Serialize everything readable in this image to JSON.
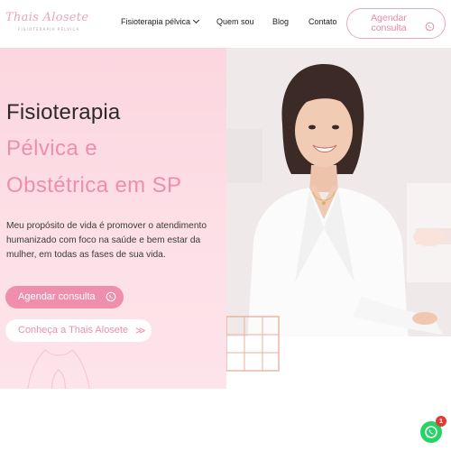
{
  "header": {
    "logo_script": "Thais Alosete",
    "logo_tagline": "FISIOTERAPIA PÉLVICA",
    "nav": {
      "fisio": "Fisioterapia pélvica",
      "quem": "Quem sou",
      "blog": "Blog",
      "contato": "Contato"
    },
    "cta_line1": "Agendar",
    "cta_line2": "consulta"
  },
  "hero": {
    "title_line1": "Fisioterapia",
    "title_line2": "Pélvica e",
    "title_line3": "Obstétrica em SP",
    "description": "Meu propósito de vida é promover o atendimento humanizado com foco na saúde e bem estar da mulher, em todas as fases de sua vida.",
    "cta_label": "Agendar consulta",
    "link_label": "Conheça a Thais Alosete",
    "link_arrows": "≫"
  },
  "whatsapp_float": {
    "badge_count": "1"
  },
  "icons": {
    "header_cta": "whatsapp-icon",
    "hero_cta": "whatsapp-icon",
    "float": "whatsapp-icon",
    "nav_dropdown": "chevron-down-icon"
  },
  "colors": {
    "brand_pink": "#ee8ead",
    "button_pink": "#f08fad",
    "hero_background": "#fcd6e0",
    "whatsapp_green": "#25d366",
    "badge_red": "#e53935"
  }
}
